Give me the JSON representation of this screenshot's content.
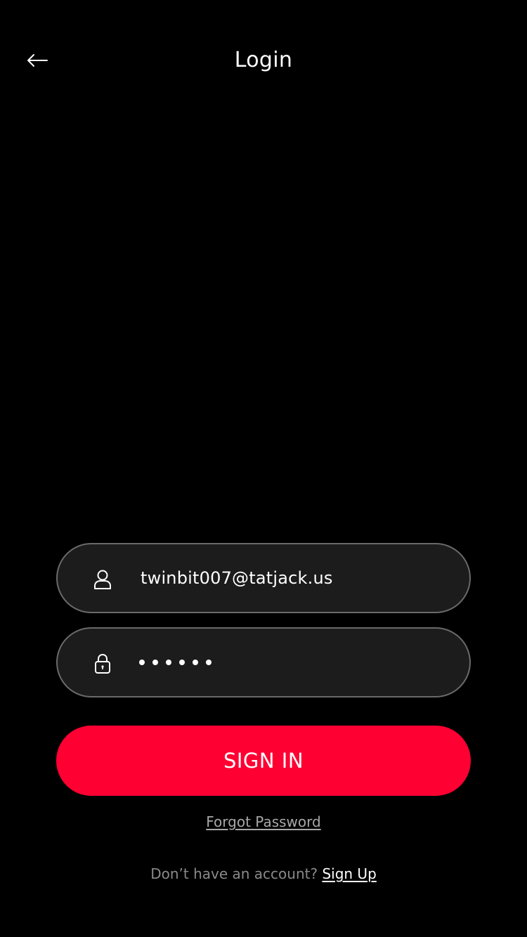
{
  "header": {
    "title": "Login",
    "back_icon": "arrow-left-icon"
  },
  "form": {
    "email": {
      "icon": "user-icon",
      "value": "twinbit007@tatjack.us"
    },
    "password": {
      "icon": "lock-icon",
      "masked_length": 6
    },
    "signin_label": "SIGN IN",
    "forgot_password_label": "Forgot Password"
  },
  "footer": {
    "prompt": "Don’t have an account?",
    "signup_label": "Sign Up"
  },
  "colors": {
    "background": "#000000",
    "field_background": "#1c1c1c",
    "field_border": "#6a6a6a",
    "accent": "#ff0033"
  }
}
